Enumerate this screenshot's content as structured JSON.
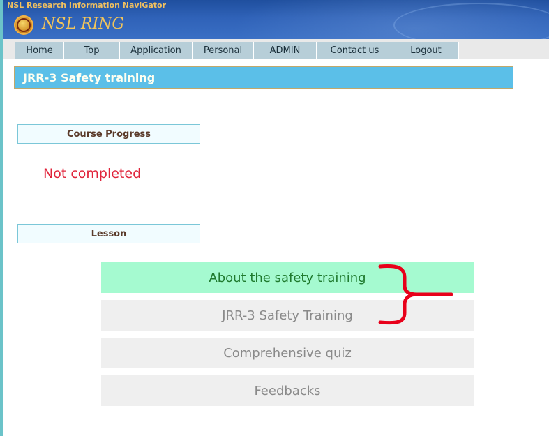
{
  "header": {
    "subtitle": "NSL Research Information NaviGator",
    "title": "NSL RING",
    "logo_icon": "logo-emblem-icon"
  },
  "nav": {
    "tabs": [
      {
        "label": "Home"
      },
      {
        "label": "Top"
      },
      {
        "label": "Application"
      },
      {
        "label": "Personal"
      },
      {
        "label": "ADMIN"
      },
      {
        "label": "Contact us"
      },
      {
        "label": "Logout"
      }
    ]
  },
  "page": {
    "title": "JRR-3 Safety training"
  },
  "progress": {
    "label": "Course Progress",
    "status": "Not completed"
  },
  "lessons": {
    "label": "Lesson",
    "items": [
      {
        "label": "About the safety training",
        "active": true
      },
      {
        "label": "JRR-3 Safety Training",
        "active": false
      },
      {
        "label": "Comprehensive quiz",
        "active": false
      },
      {
        "label": "Feedbacks",
        "active": false
      }
    ]
  },
  "colors": {
    "header_bg": "#2f62b8",
    "title_banner": "#5bbfe8",
    "status_red": "#e0233a",
    "lesson_active": "#a5fad0",
    "lesson_inactive": "#efefef",
    "annotation_red": "#e8001a"
  }
}
